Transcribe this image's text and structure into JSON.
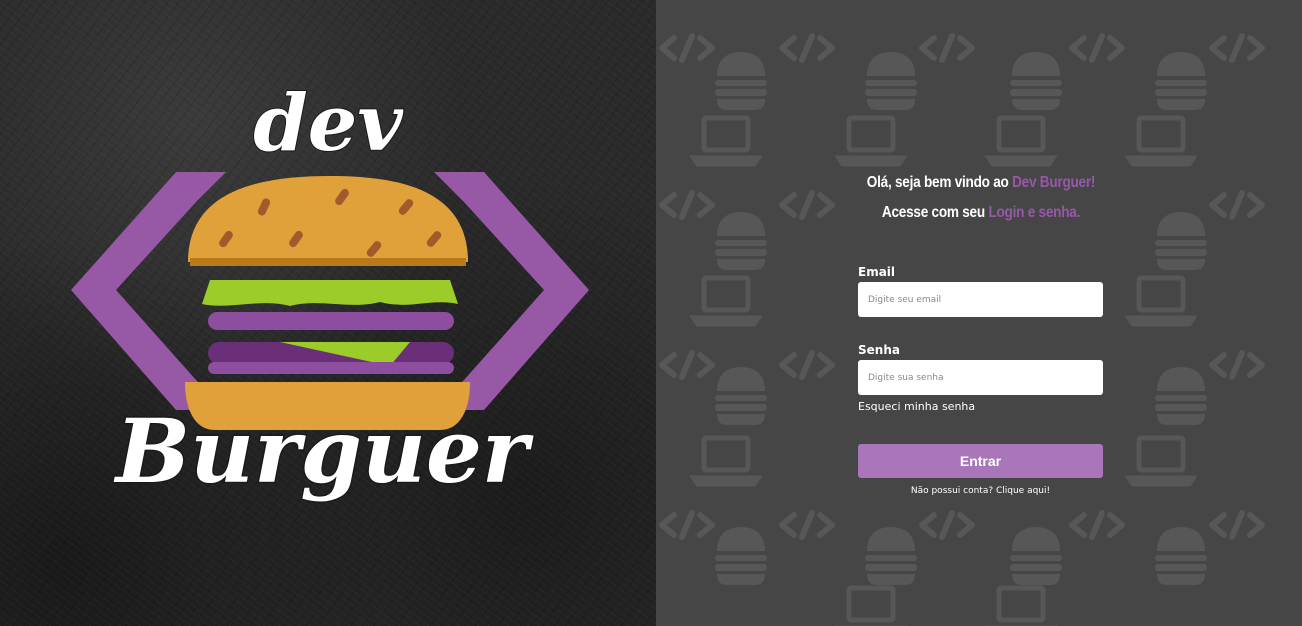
{
  "left_panel": {
    "logo_text_top": "dev",
    "logo_text_bottom": "Burguer"
  },
  "welcome": {
    "line1_prefix": "Olá, seja bem vindo ao ",
    "line1_accent": "Dev Burguer!",
    "line2_prefix": "Acesse com seu ",
    "line2_accent": "Login e senha."
  },
  "form": {
    "email_label": "Email",
    "email_placeholder": "Digite seu email",
    "email_value": "",
    "password_label": "Senha",
    "password_placeholder": "Digite sua senha",
    "password_value": "",
    "forgot_link": "Esqueci minha senha",
    "submit_label": "Entrar",
    "signup_text": "Não possui conta? Clique aqui!"
  },
  "colors": {
    "accent": "#9758a6",
    "button": "#a976ba",
    "right_bg": "#464646",
    "pattern_icon": "#575757",
    "bun": "#e0a13a",
    "lettuce": "#9ccc29"
  },
  "icons": [
    "code-icon",
    "burger-icon",
    "laptop-icon"
  ]
}
